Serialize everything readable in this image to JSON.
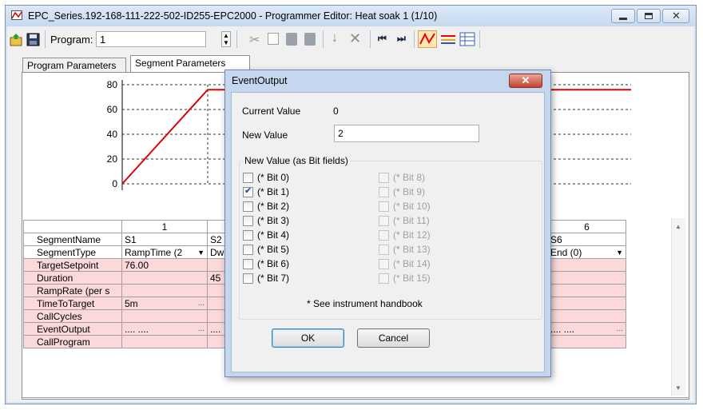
{
  "window": {
    "title": "EPC_Series.192-168-111-222-502-ID255-EPC2000 - Programmer Editor: Heat soak 1 (1/10)"
  },
  "toolbar": {
    "program_label": "Program:",
    "program_value": "1"
  },
  "tabs": [
    {
      "label": "Program Parameters"
    },
    {
      "label": "Segment Parameters"
    }
  ],
  "chart_data": {
    "type": "line",
    "yticks": [
      "80",
      "60",
      "40",
      "20",
      "0"
    ],
    "ylim": [
      0,
      80
    ],
    "series": [
      {
        "color": "#e00000",
        "points": [
          [
            0,
            0
          ],
          [
            1,
            76
          ],
          [
            2,
            76
          ]
        ]
      }
    ]
  },
  "grid": {
    "columns": [
      "1",
      "",
      "",
      "",
      "",
      "6"
    ],
    "rows": [
      {
        "label": "SegmentName",
        "pink": false,
        "c1": "S1",
        "c2": "S2",
        "c6": "S6"
      },
      {
        "label": "SegmentType",
        "pink": false,
        "c1": "RampTime (2",
        "c2": "Dw",
        "c6": "End (0)"
      },
      {
        "label": "TargetSetpoint",
        "pink": true,
        "c1": "76.00",
        "c2": "",
        "c6": ""
      },
      {
        "label": "Duration",
        "pink": true,
        "c1": "",
        "c2": "45",
        "c6": ""
      },
      {
        "label": "RampRate (per s",
        "pink": true,
        "c1": "",
        "c2": "",
        "c6": ""
      },
      {
        "label": "TimeToTarget",
        "pink": true,
        "c1": "5m",
        "c2": "",
        "c6": ""
      },
      {
        "label": "CallCycles",
        "pink": true,
        "c1": "",
        "c2": "",
        "c6": ""
      },
      {
        "label": "EventOutput",
        "pink": true,
        "c1": ".... ....",
        "c2": "....",
        "c6": ".... ...."
      },
      {
        "label": "CallProgram",
        "pink": true,
        "c1": "",
        "c2": "",
        "c6": ""
      }
    ]
  },
  "dialog": {
    "title": "EventOutput",
    "current_value_label": "Current Value",
    "current_value": "0",
    "new_value_label": "New Value",
    "new_value": "2",
    "bits_group_label": "New Value (as Bit fields)",
    "bits_left": [
      {
        "label": "(* Bit 0)",
        "checked": false
      },
      {
        "label": "(* Bit 1)",
        "checked": true
      },
      {
        "label": "(* Bit 2)",
        "checked": false
      },
      {
        "label": "(* Bit 3)",
        "checked": false
      },
      {
        "label": "(* Bit 4)",
        "checked": false
      },
      {
        "label": "(* Bit 5)",
        "checked": false
      },
      {
        "label": "(* Bit 6)",
        "checked": false
      },
      {
        "label": "(* Bit 7)",
        "checked": false
      }
    ],
    "bits_right": [
      {
        "label": "(* Bit 8)"
      },
      {
        "label": "(* Bit 9)"
      },
      {
        "label": "(* Bit 10)"
      },
      {
        "label": "(* Bit 11)"
      },
      {
        "label": "(* Bit 12)"
      },
      {
        "label": "(* Bit 13)"
      },
      {
        "label": "(* Bit 14)"
      },
      {
        "label": "(* Bit 15)"
      }
    ],
    "footnote": "* See instrument handbook",
    "ok_label": "OK",
    "cancel_label": "Cancel"
  }
}
